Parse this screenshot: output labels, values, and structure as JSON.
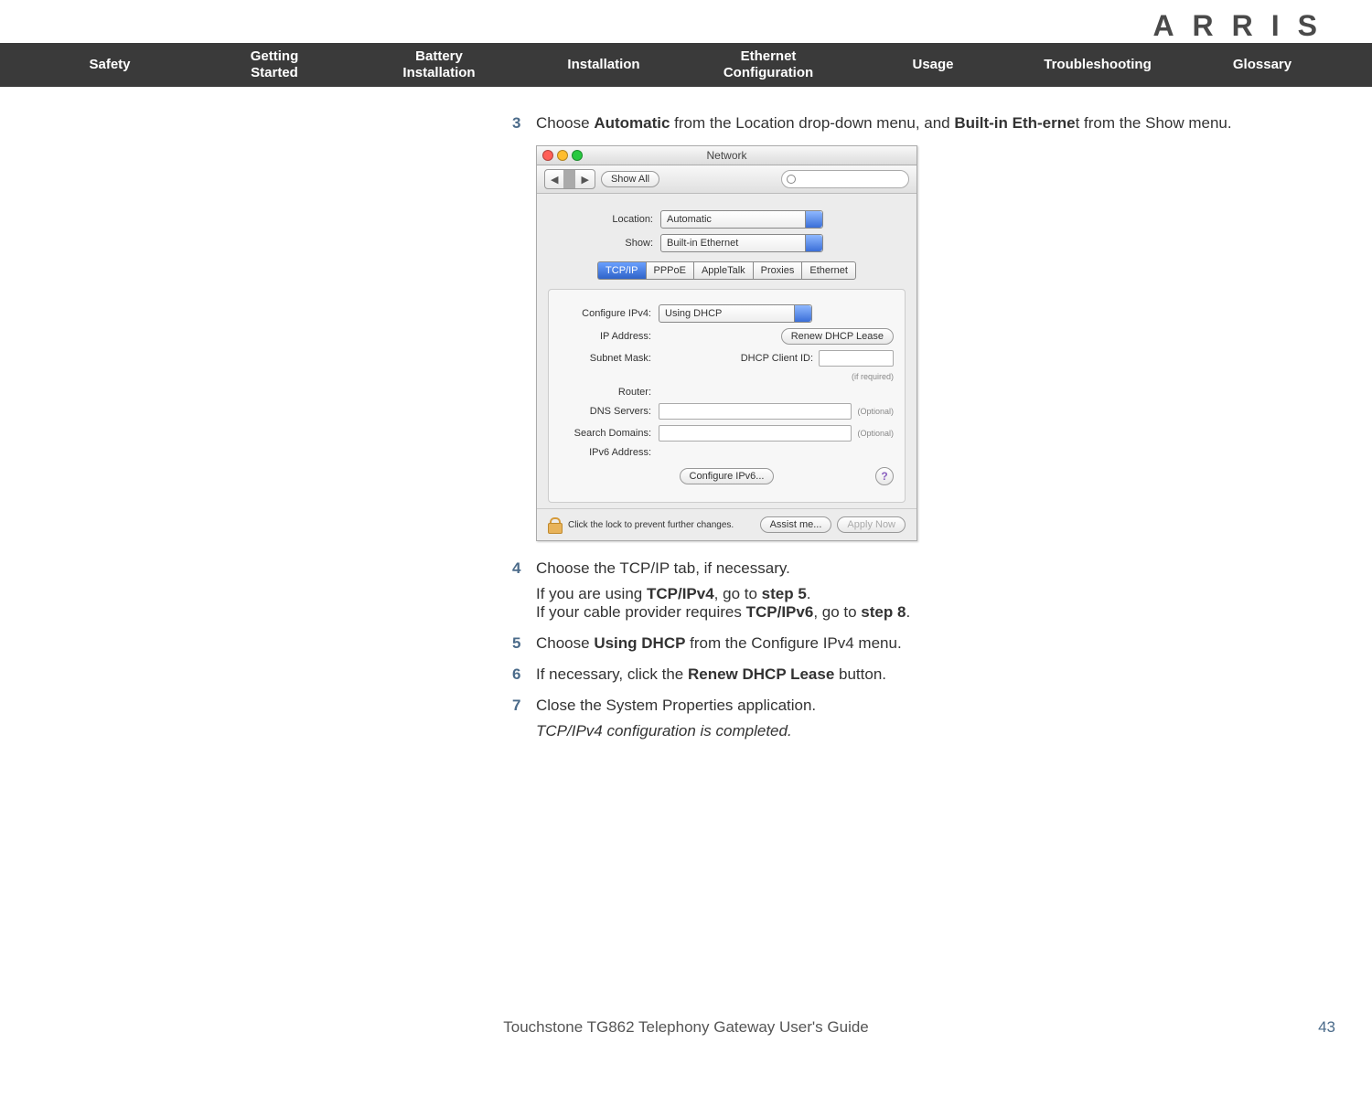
{
  "logo": "ARRIS",
  "nav": {
    "items": [
      "Safety",
      "Getting\nStarted",
      "Battery\nInstallation",
      "Installation",
      "Ethernet\nConfiguration",
      "Usage",
      "Troubleshooting",
      "Glossary"
    ]
  },
  "steps": {
    "s3": {
      "num": "3",
      "pre": "Choose ",
      "b1": "Automatic",
      "mid": " from the Location drop-down menu, and ",
      "b2": "Built-in Eth-erne",
      "post": "t from the Show menu."
    },
    "s4": {
      "num": "4",
      "text": "Choose the TCP/IP tab, if necessary.",
      "l2a": "If you are using ",
      "l2b": "TCP/IPv4",
      "l2c": ", go to ",
      "l2d": "step 5",
      "l2e": ".",
      "l3a": "If your cable provider requires ",
      "l3b": "TCP/IPv6",
      "l3c": ", go to ",
      "l3d": "step 8",
      "l3e": "."
    },
    "s5": {
      "num": "5",
      "pre": "Choose ",
      "b": "Using DHCP",
      "post": " from the Configure IPv4 menu."
    },
    "s6": {
      "num": "6",
      "pre": "If necessary, click the ",
      "b": "Renew DHCP Lease",
      "post": " button."
    },
    "s7": {
      "num": "7",
      "text": "Close the System Properties application.",
      "ital": "TCP/IPv4 configuration is completed."
    }
  },
  "mac": {
    "title": "Network",
    "showall": "Show All",
    "location_lbl": "Location:",
    "location_val": "Automatic",
    "show_lbl": "Show:",
    "show_val": "Built-in Ethernet",
    "tabs": [
      "TCP/IP",
      "PPPoE",
      "AppleTalk",
      "Proxies",
      "Ethernet"
    ],
    "cfg_lbl": "Configure IPv4:",
    "cfg_val": "Using DHCP",
    "ip_lbl": "IP Address:",
    "renew": "Renew DHCP Lease",
    "subnet_lbl": "Subnet Mask:",
    "dhcp_id_lbl": "DHCP Client ID:",
    "if_required": "(if required)",
    "router_lbl": "Router:",
    "dns_lbl": "DNS Servers:",
    "search_lbl": "Search Domains:",
    "ipv6_lbl": "IPv6 Address:",
    "optional": "(Optional)",
    "cfg6_btn": "Configure IPv6...",
    "help": "?",
    "lock_text": "Click the lock to prevent further changes.",
    "assist": "Assist me...",
    "apply": "Apply Now"
  },
  "footer": {
    "title": "Touchstone TG862 Telephony Gateway User's Guide",
    "page": "43"
  }
}
